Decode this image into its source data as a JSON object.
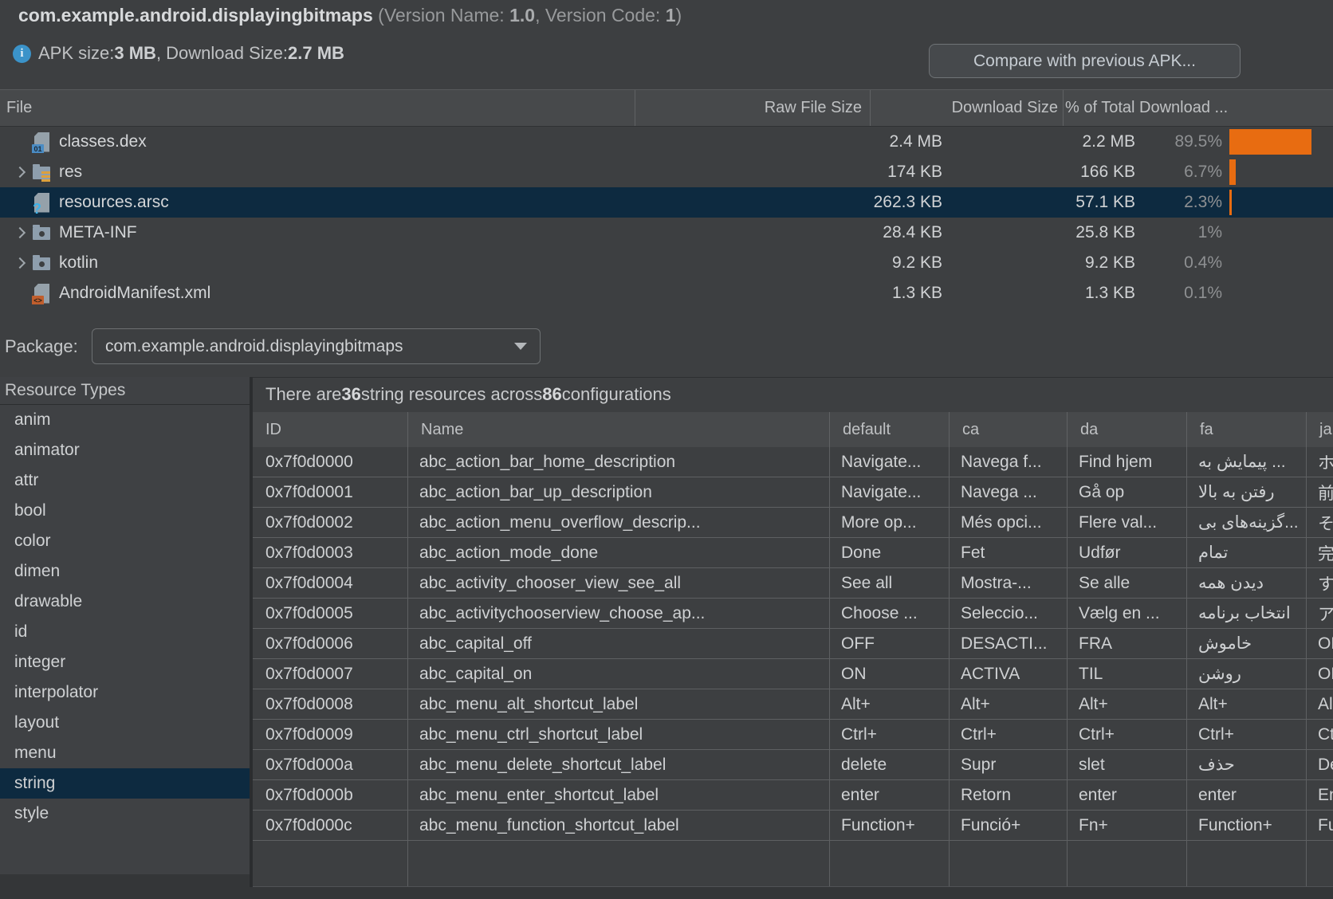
{
  "header": {
    "app_id": "com.example.android.displayingbitmaps",
    "version_prefix": " (Version Name: ",
    "version_name": "1.0",
    "version_mid": ", Version Code: ",
    "version_code": "1",
    "version_suffix": ")",
    "apk_label": "APK size: ",
    "apk_size": "3 MB",
    "download_label": ", Download Size: ",
    "download_size": "2.7 MB",
    "compare_button": "Compare with previous APK..."
  },
  "icons": {
    "info": "i",
    "dex_badge": "01",
    "arsc_badge": "?",
    "xml_badge": "<>"
  },
  "file_table": {
    "columns": [
      "File",
      "Raw File Size",
      "Download Size",
      "% of Total Download ..."
    ],
    "rows": [
      {
        "name": "classes.dex",
        "icon": "dex-file",
        "expandable": false,
        "selected": false,
        "raw": "2.4 MB",
        "download": "2.2 MB",
        "percent": "89.5%",
        "percent_value": 89.5
      },
      {
        "name": "res",
        "icon": "res-folder",
        "expandable": true,
        "selected": false,
        "raw": "174 KB",
        "download": "166 KB",
        "percent": "6.7%",
        "percent_value": 6.7
      },
      {
        "name": "resources.arsc",
        "icon": "arsc-file",
        "expandable": false,
        "selected": true,
        "raw": "262.3 KB",
        "download": "57.1 KB",
        "percent": "2.3%",
        "percent_value": 2.3
      },
      {
        "name": "META-INF",
        "icon": "folder",
        "expandable": true,
        "selected": false,
        "raw": "28.4 KB",
        "download": "25.8 KB",
        "percent": "1%",
        "percent_value": 1
      },
      {
        "name": "kotlin",
        "icon": "folder",
        "expandable": true,
        "selected": false,
        "raw": "9.2 KB",
        "download": "9.2 KB",
        "percent": "0.4%",
        "percent_value": 0.4
      },
      {
        "name": "AndroidManifest.xml",
        "icon": "xml-file",
        "expandable": false,
        "selected": false,
        "raw": "1.3 KB",
        "download": "1.3 KB",
        "percent": "0.1%",
        "percent_value": 0.1
      }
    ]
  },
  "package_bar": {
    "label": "Package:",
    "value": "com.example.android.displayingbitmaps"
  },
  "resource_panel": {
    "title": "Resource Types",
    "types": [
      "anim",
      "animator",
      "attr",
      "bool",
      "color",
      "dimen",
      "drawable",
      "id",
      "integer",
      "interpolator",
      "layout",
      "menu",
      "string",
      "style"
    ],
    "selected": "string",
    "summary_prefix": "There are ",
    "summary_count": "36",
    "summary_mid": " string resources across ",
    "summary_configs": "86",
    "summary_suffix": " configurations"
  },
  "string_table": {
    "columns": [
      "ID",
      "Name",
      "default",
      "ca",
      "da",
      "fa",
      "ja"
    ],
    "rows": [
      [
        "0x7f0d0000",
        "abc_action_bar_home_description",
        "Navigate...",
        "Navega f...",
        "Find hjem",
        "پیمایش به ...",
        "ホ"
      ],
      [
        "0x7f0d0001",
        "abc_action_bar_up_description",
        "Navigate...",
        "Navega ...",
        "Gå op",
        "رفتن به بالا",
        "前"
      ],
      [
        "0x7f0d0002",
        "abc_action_menu_overflow_descrip...",
        "More op...",
        "Més opci...",
        "Flere val...",
        "گزینه‌های بی...",
        "そ"
      ],
      [
        "0x7f0d0003",
        "abc_action_mode_done",
        "Done",
        "Fet",
        "Udfør",
        "تمام",
        "完"
      ],
      [
        "0x7f0d0004",
        "abc_activity_chooser_view_see_all",
        "See all",
        "Mostra-...",
        "Se alle",
        "دیدن همه",
        "す"
      ],
      [
        "0x7f0d0005",
        "abc_activitychooserview_choose_ap...",
        "Choose ...",
        "Seleccio...",
        "Vælg en ...",
        "انتخاب برنامه",
        "ア"
      ],
      [
        "0x7f0d0006",
        "abc_capital_off",
        "OFF",
        "DESACTI...",
        "FRA",
        "خاموش",
        "OF"
      ],
      [
        "0x7f0d0007",
        "abc_capital_on",
        "ON",
        "ACTIVA",
        "TIL",
        "روشن",
        "ON"
      ],
      [
        "0x7f0d0008",
        "abc_menu_alt_shortcut_label",
        "Alt+",
        "Alt+",
        "Alt+",
        "Alt+",
        "Al"
      ],
      [
        "0x7f0d0009",
        "abc_menu_ctrl_shortcut_label",
        "Ctrl+",
        "Ctrl+",
        "Ctrl+",
        "Ctrl+",
        "Ct"
      ],
      [
        "0x7f0d000a",
        "abc_menu_delete_shortcut_label",
        "delete",
        "Supr",
        "slet",
        "حذف",
        "De"
      ],
      [
        "0x7f0d000b",
        "abc_menu_enter_shortcut_label",
        "enter",
        "Retorn",
        "enter",
        "enter",
        "En"
      ],
      [
        "0x7f0d000c",
        "abc_menu_function_shortcut_label",
        "Function+",
        "Funció+",
        "Fn+",
        "Function+",
        "Fu"
      ]
    ]
  },
  "colors": {
    "accent_orange": "#e86c11",
    "selection_blue": "#0d2a40"
  }
}
